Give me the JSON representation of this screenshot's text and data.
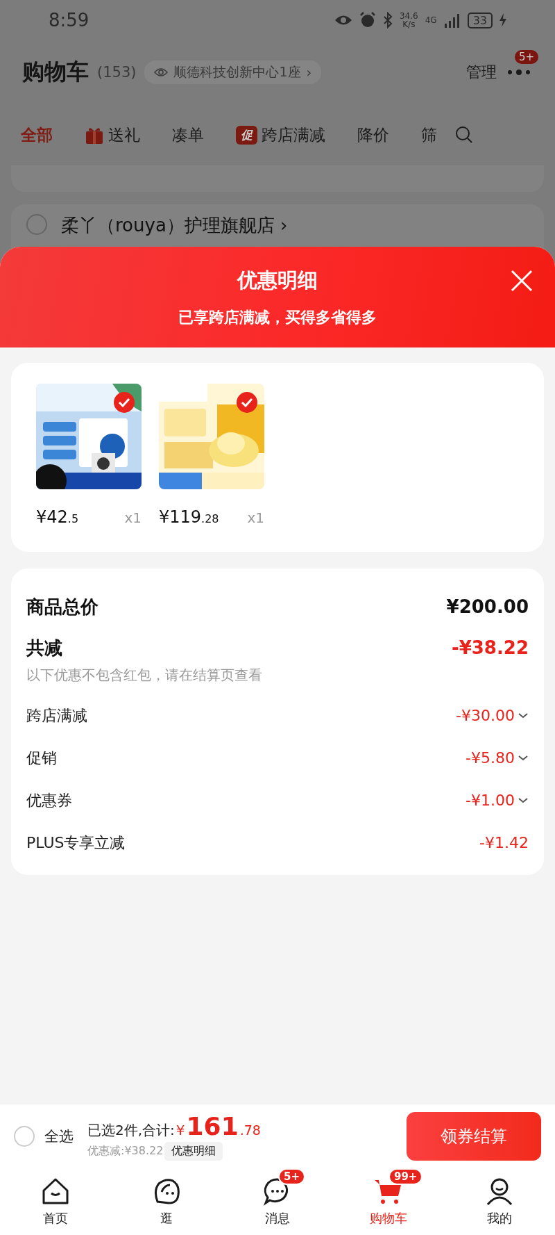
{
  "status_bar": {
    "time": "8:59",
    "speed": "34.6",
    "speed_unit": "K/s",
    "network": "4G",
    "battery": "33"
  },
  "header": {
    "title": "购物车",
    "count": "(153)",
    "location": "顺德科技创新中心1座",
    "location_chevron": "›",
    "manage": "管理",
    "more_badge": "5+"
  },
  "filter_tabs": [
    {
      "label": "全部",
      "selected": true,
      "kind": "plain"
    },
    {
      "label": "送礼",
      "selected": false,
      "kind": "gift"
    },
    {
      "label": "凑单",
      "selected": false,
      "kind": "plain"
    },
    {
      "label": "跨店满减",
      "selected": false,
      "kind": "tag",
      "tag": "促"
    },
    {
      "label": "降价",
      "selected": false,
      "kind": "plain"
    },
    {
      "label": "筛",
      "selected": false,
      "kind": "plain"
    }
  ],
  "store": {
    "name": "柔丫（rouya）护理旗舰店",
    "chevron": "›",
    "checked": false
  },
  "sheet": {
    "title": "优惠明细",
    "subtitle": "已享跨店满减，买得多省得多",
    "products": [
      {
        "kind": "picture",
        "checked": true,
        "price_main": "¥42",
        "price_decimal": ".5",
        "quantity": "x1"
      },
      {
        "kind": "picture",
        "checked": true,
        "price_main": "¥119",
        "price_decimal": ".28",
        "quantity": "x1"
      }
    ],
    "total": {
      "label": "商品总价",
      "value": "¥200.00"
    },
    "reduction": {
      "label": "共减",
      "value": "-¥38.22",
      "note": "以下优惠不包含红包，请在结算页查看"
    },
    "items": [
      {
        "label": "跨店满减",
        "value": "-¥30.00",
        "expandable": true
      },
      {
        "label": "促销",
        "value": "-¥5.80",
        "expandable": true
      },
      {
        "label": "优惠券",
        "value": "-¥1.00",
        "expandable": true
      },
      {
        "label": "PLUS专享立减",
        "value": "-¥1.42",
        "expandable": false
      }
    ]
  },
  "footer": {
    "select_all": {
      "label": "全选",
      "checked": false
    },
    "selected_text": "已选2件,合计:",
    "currency": "¥",
    "total_int": "161",
    "total_dec": ".78",
    "discount": "优惠减:¥38.22",
    "detail_button": "优惠明细",
    "checkout": "领券结算"
  },
  "tabbar": [
    {
      "kind": "home",
      "label": "首页",
      "selected": false
    },
    {
      "kind": "explore",
      "label": "逛",
      "selected": false
    },
    {
      "kind": "message",
      "label": "消息",
      "selected": false,
      "badge": "5+"
    },
    {
      "kind": "cart",
      "label": "购物车",
      "selected": true,
      "badge": "99+"
    },
    {
      "kind": "profile",
      "label": "我的",
      "selected": false
    }
  ]
}
